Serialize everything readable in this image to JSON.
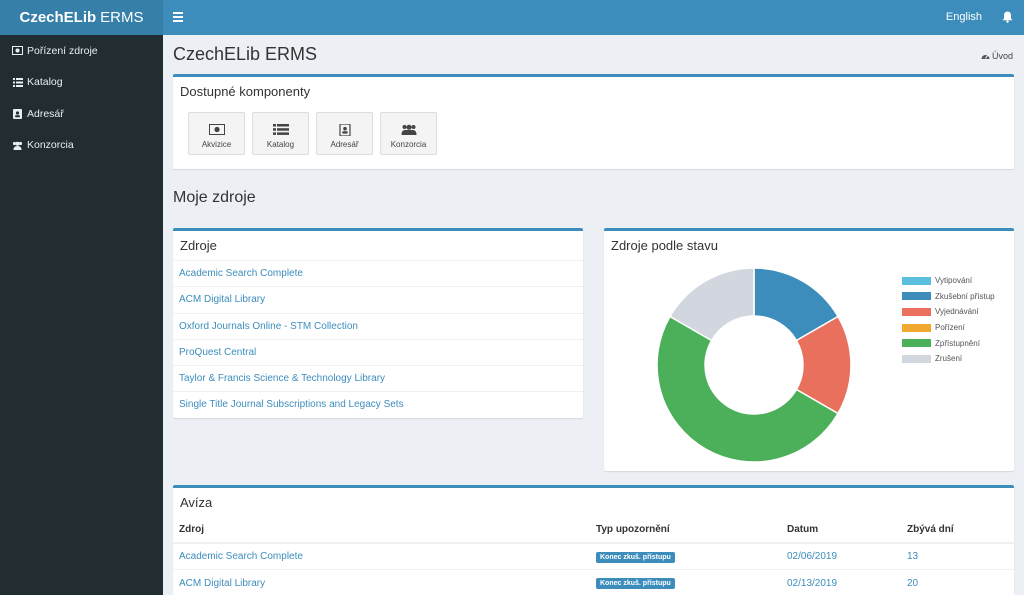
{
  "app": {
    "name_bold": "CzechELib",
    "name_light": "ERMS",
    "language": "English"
  },
  "sidebar": {
    "items": [
      {
        "label": "Pořízení zdroje",
        "icon": "money-icon"
      },
      {
        "label": "Katalog",
        "icon": "list-icon"
      },
      {
        "label": "Adresář",
        "icon": "address-book-icon"
      },
      {
        "label": "Konzorcia",
        "icon": "users-icon"
      }
    ]
  },
  "header": {
    "title": "CzechELib ERMS",
    "breadcrumb": "Úvod"
  },
  "components": {
    "title": "Dostupné komponenty",
    "items": [
      {
        "label": "Akvizice",
        "icon": "money-icon"
      },
      {
        "label": "Katalog",
        "icon": "list-icon"
      },
      {
        "label": "Adresář",
        "icon": "address-book-icon"
      },
      {
        "label": "Konzorcia",
        "icon": "users-icon"
      }
    ]
  },
  "my_resources": {
    "title": "Moje zdroje"
  },
  "resources": {
    "title": "Zdroje",
    "items": [
      "Academic Search Complete",
      "ACM Digital Library",
      "Oxford Journals Online - STM Collection",
      "ProQuest Central",
      "Taylor & Francis Science & Technology Library",
      "Single Title Journal Subscriptions and Legacy Sets"
    ]
  },
  "chart_data": {
    "type": "pie",
    "title": "Zdroje podle stavu",
    "labels": [
      "Vytipování",
      "Zkušební přístup",
      "Vyjednávání",
      "Pořízení",
      "Zpřístupnění",
      "Zrušení"
    ],
    "values": [
      0,
      1,
      1,
      0,
      3,
      1
    ],
    "colors": [
      "#5bc0de",
      "#3c8dbc",
      "#e8705c",
      "#f0a830",
      "#4caf5a",
      "#d2d6de"
    ],
    "legend_position": "right"
  },
  "notices": {
    "title": "Avíza",
    "columns": [
      "Zdroj",
      "Typ upozornění",
      "Datum",
      "Zbývá dní"
    ],
    "rows": [
      {
        "resource": "Academic Search Complete",
        "type": "Konec zkuš. přístupu",
        "date": "02/06/2019",
        "days": "13"
      },
      {
        "resource": "ACM Digital Library",
        "type": "Konec zkuš. přístupu",
        "date": "02/13/2019",
        "days": "20"
      }
    ]
  }
}
